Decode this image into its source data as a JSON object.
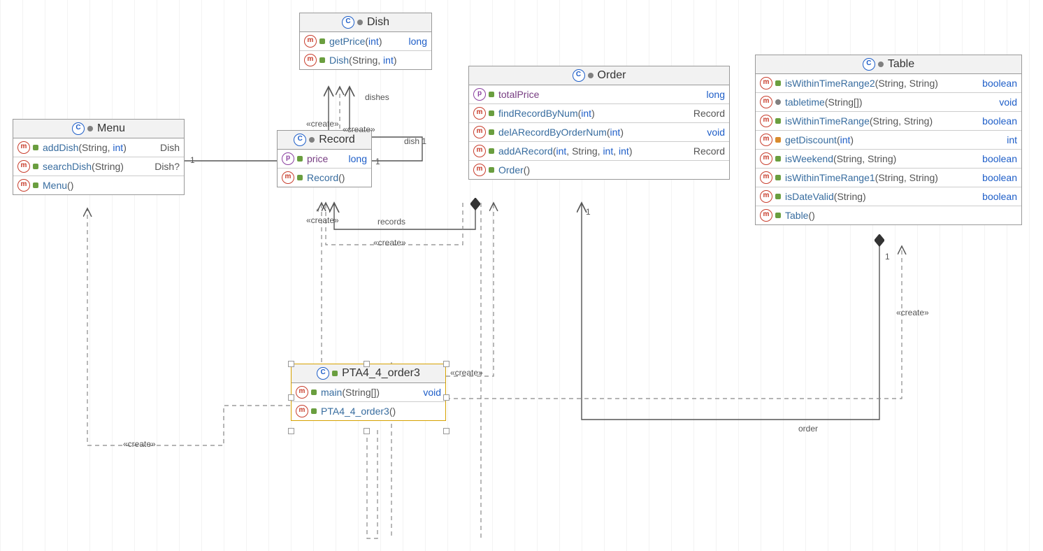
{
  "classes": {
    "dish": {
      "name": "Dish",
      "members": {
        "getPrice": {
          "name": "getPrice",
          "params": "int",
          "ret": "long"
        },
        "ctor": {
          "name": "Dish",
          "params_prefix": "String, ",
          "params_kw": "int"
        }
      }
    },
    "menu": {
      "name": "Menu",
      "members": {
        "addDish": {
          "name": "addDish",
          "params_prefix": "String, ",
          "params_kw": "int",
          "ret": "Dish"
        },
        "searchDish": {
          "name": "searchDish",
          "params": "String",
          "ret": "Dish?"
        },
        "ctor": {
          "name": "Menu"
        }
      }
    },
    "record": {
      "name": "Record",
      "members": {
        "price": {
          "name": "price",
          "ret": "long"
        },
        "ctor": {
          "name": "Record"
        }
      }
    },
    "order": {
      "name": "Order",
      "members": {
        "totalPrice": {
          "name": "totalPrice",
          "ret": "long"
        },
        "findRecord": {
          "name": "findRecordByNum",
          "params_kw": "int",
          "ret": "Record"
        },
        "delRecord": {
          "name": "delARecordByOrderNum",
          "params_kw": "int",
          "ret": "void"
        },
        "addRecord": {
          "name": "addARecord",
          "params_prefix": "int",
          "params_mid": ", String, ",
          "params_kw2": "int",
          "params_sep": ", ",
          "params_kw3": "int",
          "ret": "Record"
        },
        "ctor": {
          "name": "Order"
        }
      }
    },
    "table": {
      "name": "Table",
      "members": {
        "isWithin2": {
          "name": "isWithinTimeRange2",
          "params": "String, String",
          "ret": "boolean"
        },
        "tabletime": {
          "name": "tabletime",
          "params": "String[]",
          "ret": "void"
        },
        "isWithin": {
          "name": "isWithinTimeRange",
          "params": "String, String",
          "ret": "boolean"
        },
        "getDiscount": {
          "name": "getDiscount",
          "params_kw": "int",
          "ret": "int"
        },
        "isWeekend": {
          "name": "isWeekend",
          "params": "String, String",
          "ret": "boolean"
        },
        "isWithin1": {
          "name": "isWithinTimeRange1",
          "params": "String, String",
          "ret": "boolean"
        },
        "isDateValid": {
          "name": "isDateValid",
          "params": "String",
          "ret": "boolean"
        },
        "ctor": {
          "name": "Table"
        }
      }
    },
    "pta": {
      "name": "PTA4_4_order3",
      "members": {
        "main": {
          "name": "main",
          "params": "String[]",
          "ret": "void"
        },
        "ctor": {
          "name": "PTA4_4_order3"
        }
      }
    }
  },
  "labels": {
    "dishes": "dishes",
    "dish1": "dish  1",
    "records": "records",
    "one_a": "1",
    "one_b": "1",
    "one_c": "1",
    "one_d": "1",
    "star": "*",
    "order_lbl": "order",
    "create1": "«create»",
    "create2": "«create»",
    "create3": "«create»",
    "create4": "«create»",
    "create5": "«create»",
    "create6": "«create»"
  }
}
